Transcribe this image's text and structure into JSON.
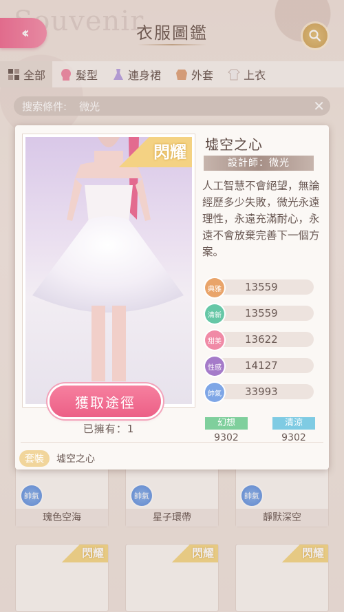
{
  "header": {
    "title": "衣服圖鑑",
    "bg_word": "Souvenir"
  },
  "tabs": [
    {
      "label": "全部",
      "icon": "grid-icon",
      "active": true
    },
    {
      "label": "髮型",
      "icon": "hair-icon",
      "active": false
    },
    {
      "label": "連身裙",
      "icon": "dress-icon",
      "active": false
    },
    {
      "label": "外套",
      "icon": "coat-icon",
      "active": false
    },
    {
      "label": "上衣",
      "icon": "shirt-icon",
      "active": false
    }
  ],
  "filter": {
    "label": "搜索條件:",
    "value": "微光"
  },
  "grid": [
    {
      "name": "瑰色空海",
      "badge": "帥氣"
    },
    {
      "name": "星子環帶",
      "badge": "帥氣"
    },
    {
      "name": "靜默深空",
      "badge": "帥氣"
    }
  ],
  "grid_tag": "閃耀",
  "modal": {
    "photo_tag": "閃耀",
    "name": "墟空之心",
    "designer": "設計師：微光",
    "description": "人工智慧不會絕望，無論經歷多少失敗，微光永遠理性，永遠充滿耐心，永遠不會放棄完善下一個方案。",
    "get_button": "獲取途徑",
    "owned": "已擁有：1",
    "suit_tag": "套裝",
    "suit_name": "墟空之心",
    "stats": [
      {
        "icon_label": "典雅",
        "value": "13559",
        "color": "#e9a46a"
      },
      {
        "icon_label": "清新",
        "value": "13559",
        "color": "#66c7a6"
      },
      {
        "icon_label": "甜美",
        "value": "13622",
        "color": "#f08aa6"
      },
      {
        "icon_label": "性感",
        "value": "14127",
        "color": "#a57bc9"
      },
      {
        "icon_label": "帥氣",
        "value": "33993",
        "color": "#7ea6e6"
      }
    ],
    "attributes": [
      {
        "label": "幻想",
        "value": "9302",
        "color": "#7fcf9c"
      },
      {
        "label": "清涼",
        "value": "9302",
        "color": "#7fcbe3"
      }
    ]
  }
}
